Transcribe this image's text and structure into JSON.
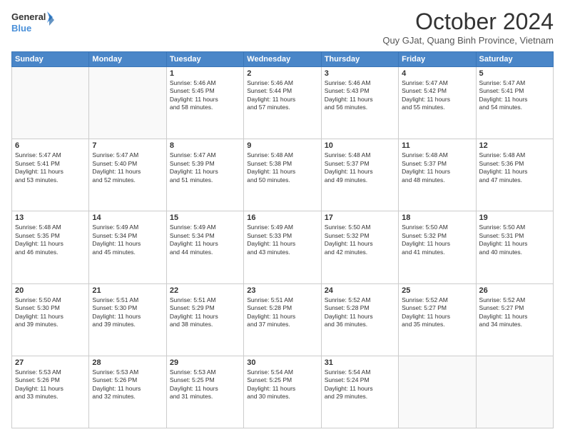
{
  "header": {
    "logo_line1": "General",
    "logo_line2": "Blue",
    "month": "October 2024",
    "location": "Quy GJat, Quang Binh Province, Vietnam"
  },
  "days_of_week": [
    "Sunday",
    "Monday",
    "Tuesday",
    "Wednesday",
    "Thursday",
    "Friday",
    "Saturday"
  ],
  "weeks": [
    [
      {
        "day": "",
        "info": ""
      },
      {
        "day": "",
        "info": ""
      },
      {
        "day": "1",
        "info": "Sunrise: 5:46 AM\nSunset: 5:45 PM\nDaylight: 11 hours\nand 58 minutes."
      },
      {
        "day": "2",
        "info": "Sunrise: 5:46 AM\nSunset: 5:44 PM\nDaylight: 11 hours\nand 57 minutes."
      },
      {
        "day": "3",
        "info": "Sunrise: 5:46 AM\nSunset: 5:43 PM\nDaylight: 11 hours\nand 56 minutes."
      },
      {
        "day": "4",
        "info": "Sunrise: 5:47 AM\nSunset: 5:42 PM\nDaylight: 11 hours\nand 55 minutes."
      },
      {
        "day": "5",
        "info": "Sunrise: 5:47 AM\nSunset: 5:41 PM\nDaylight: 11 hours\nand 54 minutes."
      }
    ],
    [
      {
        "day": "6",
        "info": "Sunrise: 5:47 AM\nSunset: 5:41 PM\nDaylight: 11 hours\nand 53 minutes."
      },
      {
        "day": "7",
        "info": "Sunrise: 5:47 AM\nSunset: 5:40 PM\nDaylight: 11 hours\nand 52 minutes."
      },
      {
        "day": "8",
        "info": "Sunrise: 5:47 AM\nSunset: 5:39 PM\nDaylight: 11 hours\nand 51 minutes."
      },
      {
        "day": "9",
        "info": "Sunrise: 5:48 AM\nSunset: 5:38 PM\nDaylight: 11 hours\nand 50 minutes."
      },
      {
        "day": "10",
        "info": "Sunrise: 5:48 AM\nSunset: 5:37 PM\nDaylight: 11 hours\nand 49 minutes."
      },
      {
        "day": "11",
        "info": "Sunrise: 5:48 AM\nSunset: 5:37 PM\nDaylight: 11 hours\nand 48 minutes."
      },
      {
        "day": "12",
        "info": "Sunrise: 5:48 AM\nSunset: 5:36 PM\nDaylight: 11 hours\nand 47 minutes."
      }
    ],
    [
      {
        "day": "13",
        "info": "Sunrise: 5:48 AM\nSunset: 5:35 PM\nDaylight: 11 hours\nand 46 minutes."
      },
      {
        "day": "14",
        "info": "Sunrise: 5:49 AM\nSunset: 5:34 PM\nDaylight: 11 hours\nand 45 minutes."
      },
      {
        "day": "15",
        "info": "Sunrise: 5:49 AM\nSunset: 5:34 PM\nDaylight: 11 hours\nand 44 minutes."
      },
      {
        "day": "16",
        "info": "Sunrise: 5:49 AM\nSunset: 5:33 PM\nDaylight: 11 hours\nand 43 minutes."
      },
      {
        "day": "17",
        "info": "Sunrise: 5:50 AM\nSunset: 5:32 PM\nDaylight: 11 hours\nand 42 minutes."
      },
      {
        "day": "18",
        "info": "Sunrise: 5:50 AM\nSunset: 5:32 PM\nDaylight: 11 hours\nand 41 minutes."
      },
      {
        "day": "19",
        "info": "Sunrise: 5:50 AM\nSunset: 5:31 PM\nDaylight: 11 hours\nand 40 minutes."
      }
    ],
    [
      {
        "day": "20",
        "info": "Sunrise: 5:50 AM\nSunset: 5:30 PM\nDaylight: 11 hours\nand 39 minutes."
      },
      {
        "day": "21",
        "info": "Sunrise: 5:51 AM\nSunset: 5:30 PM\nDaylight: 11 hours\nand 39 minutes."
      },
      {
        "day": "22",
        "info": "Sunrise: 5:51 AM\nSunset: 5:29 PM\nDaylight: 11 hours\nand 38 minutes."
      },
      {
        "day": "23",
        "info": "Sunrise: 5:51 AM\nSunset: 5:28 PM\nDaylight: 11 hours\nand 37 minutes."
      },
      {
        "day": "24",
        "info": "Sunrise: 5:52 AM\nSunset: 5:28 PM\nDaylight: 11 hours\nand 36 minutes."
      },
      {
        "day": "25",
        "info": "Sunrise: 5:52 AM\nSunset: 5:27 PM\nDaylight: 11 hours\nand 35 minutes."
      },
      {
        "day": "26",
        "info": "Sunrise: 5:52 AM\nSunset: 5:27 PM\nDaylight: 11 hours\nand 34 minutes."
      }
    ],
    [
      {
        "day": "27",
        "info": "Sunrise: 5:53 AM\nSunset: 5:26 PM\nDaylight: 11 hours\nand 33 minutes."
      },
      {
        "day": "28",
        "info": "Sunrise: 5:53 AM\nSunset: 5:26 PM\nDaylight: 11 hours\nand 32 minutes."
      },
      {
        "day": "29",
        "info": "Sunrise: 5:53 AM\nSunset: 5:25 PM\nDaylight: 11 hours\nand 31 minutes."
      },
      {
        "day": "30",
        "info": "Sunrise: 5:54 AM\nSunset: 5:25 PM\nDaylight: 11 hours\nand 30 minutes."
      },
      {
        "day": "31",
        "info": "Sunrise: 5:54 AM\nSunset: 5:24 PM\nDaylight: 11 hours\nand 29 minutes."
      },
      {
        "day": "",
        "info": ""
      },
      {
        "day": "",
        "info": ""
      }
    ]
  ]
}
